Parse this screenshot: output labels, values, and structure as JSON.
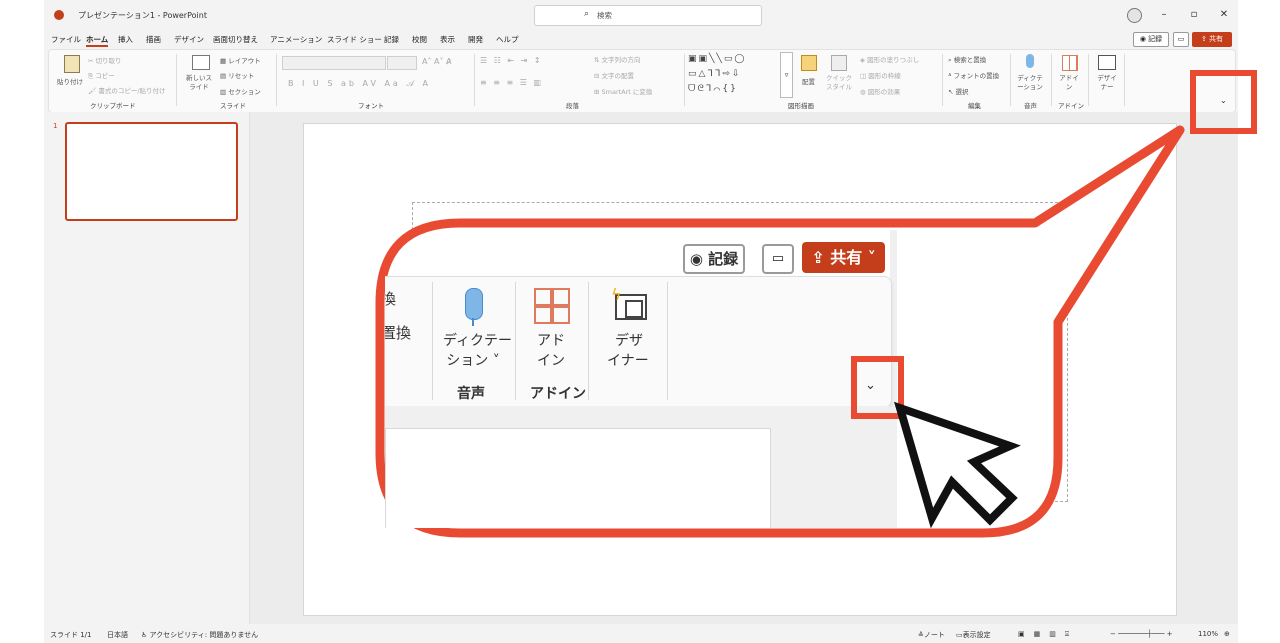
{
  "titlebar": {
    "doc_title": "プレゼンテーション1 - PowerPoint",
    "search_placeholder": "検索"
  },
  "menu": {
    "tabs": [
      "ファイル",
      "ホーム",
      "挿入",
      "描画",
      "デザイン",
      "画面切り替え",
      "アニメーション",
      "スライド ショー",
      "記録",
      "校閲",
      "表示",
      "開発",
      "ヘルプ"
    ],
    "active_tab": "ホーム"
  },
  "top_buttons": {
    "record": "記録",
    "share": "共有"
  },
  "ribbon": {
    "clipboard": {
      "paste": "貼り付け",
      "cut": "切り取り",
      "copy": "コピー",
      "format_painter": "書式のコピー/貼り付け",
      "group": "クリップボード"
    },
    "slides": {
      "new_slide": "新しいスライド",
      "layout": "レイアウト",
      "reset": "リセット",
      "section": "セクション",
      "group": "スライド"
    },
    "font": {
      "group": "フォント"
    },
    "paragraph": {
      "text_direction": "文字列の方向",
      "align_text": "文字の配置",
      "smartart": "SmartArt に変換",
      "group": "段落"
    },
    "drawing": {
      "arrange": "配置",
      "quick_styles": "クイックスタイル",
      "shape_fill": "図形の塗りつぶし",
      "shape_outline": "図形の枠線",
      "shape_effects": "図形の効果",
      "group": "図形描画"
    },
    "editing": {
      "find_replace": "検索と置換",
      "replace_font": "フォントの置換",
      "select": "選択",
      "group": "編集"
    },
    "voice": {
      "dictate": "ディクテーション",
      "group": "音声"
    },
    "addins": {
      "addins": "アドイン",
      "group": "アドイン"
    },
    "designer": {
      "label": "デザイナー"
    }
  },
  "thumbnail": {
    "number": "1"
  },
  "statusbar": {
    "slide": "スライド 1/1",
    "language": "日本語",
    "accessibility": "アクセシビリティ: 問題ありません",
    "notes": "ノート",
    "display_settings": "表示設定",
    "zoom": "110%"
  },
  "callout": {
    "record": "記録",
    "share": "共有",
    "partial_1": "換",
    "partial_2": "置換",
    "dictate_1": "ディクテー",
    "dictate_2": "ション",
    "voice_group": "音声",
    "addin_1": "アド",
    "addin_2": "イン",
    "addin_group": "アドイン",
    "designer_1": "デザ",
    "designer_2": "イナー"
  },
  "colors": {
    "accent": "#c43e1c",
    "highlight": "#e84a32"
  }
}
